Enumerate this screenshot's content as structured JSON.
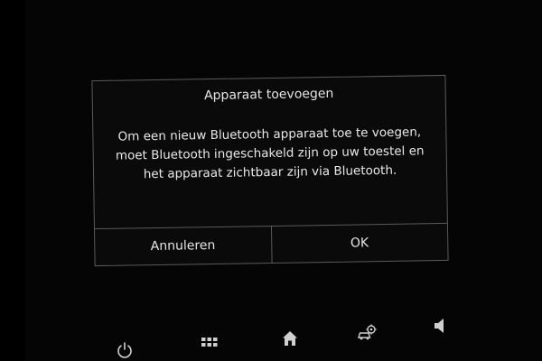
{
  "dialog": {
    "title": "Apparaat toevoegen",
    "message_lines": [
      "Om een nieuw Bluetooth apparaat toe te voegen,",
      "moet Bluetooth ingeschakeld zijn op uw toestel en",
      "het apparaat zichtbaar zijn via Bluetooth."
    ],
    "cancel_label": "Annuleren",
    "ok_label": "OK"
  },
  "nav": {
    "icons": [
      "power-icon",
      "apps-grid-icon",
      "home-icon",
      "car-settings-icon",
      "volume-icon"
    ]
  },
  "colors": {
    "background": "#000000",
    "dialog_border": "#5a5a5a",
    "text": "#e8e8e8"
  }
}
